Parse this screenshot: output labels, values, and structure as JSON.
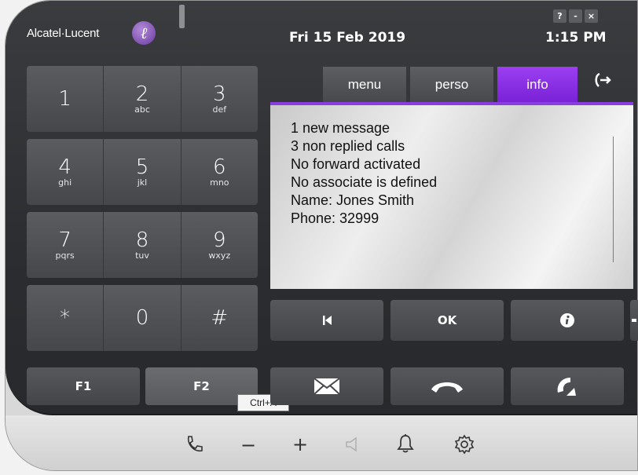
{
  "header": {
    "brand": "Alcatel·Lucent",
    "brand_logo_glyph": "ℓ",
    "date": "Fri 15 Feb 2019",
    "time": "1:15  PM"
  },
  "window_controls": {
    "help": "?",
    "minimize": "-",
    "close": "×"
  },
  "keypad": {
    "rows": [
      [
        {
          "digit": "1",
          "letters": ""
        },
        {
          "digit": "2",
          "letters": "abc"
        },
        {
          "digit": "3",
          "letters": "def"
        }
      ],
      [
        {
          "digit": "4",
          "letters": "ghi"
        },
        {
          "digit": "5",
          "letters": "jkl"
        },
        {
          "digit": "6",
          "letters": "mno"
        }
      ],
      [
        {
          "digit": "7",
          "letters": "pqrs"
        },
        {
          "digit": "8",
          "letters": "tuv"
        },
        {
          "digit": "9",
          "letters": "wxyz"
        }
      ],
      [
        {
          "digit": "*",
          "letters": ""
        },
        {
          "digit": "0",
          "letters": ""
        },
        {
          "digit": "#",
          "letters": ""
        }
      ]
    ]
  },
  "function_keys": {
    "f1": "F1",
    "f2": "F2"
  },
  "tooltip": "Ctrl+A",
  "tabs": [
    {
      "label": "menu",
      "active": false
    },
    {
      "label": "perso",
      "active": false
    },
    {
      "label": "info",
      "active": true
    }
  ],
  "screen": {
    "lines": [
      "1 new message",
      "3 non replied calls",
      "No forward activated",
      "No associate is defined",
      "Name: Jones Smith",
      "Phone: 32999"
    ]
  },
  "nav_buttons": {
    "ok": "OK",
    "back_icon": "skip-back-icon",
    "info_icon": "info-icon"
  },
  "action_buttons": [
    "mail-icon",
    "hangup-icon",
    "call-forward-icon"
  ],
  "bottom_controls": [
    "handset-icon",
    "volume-down-icon",
    "volume-up-icon",
    "speaker-icon",
    "bell-icon",
    "settings-icon"
  ],
  "bottom_labels": {
    "minus": "−",
    "plus": "+"
  },
  "colors": {
    "accent": "#8a2be2",
    "body": "#2e3033",
    "key": "#4e5054"
  }
}
